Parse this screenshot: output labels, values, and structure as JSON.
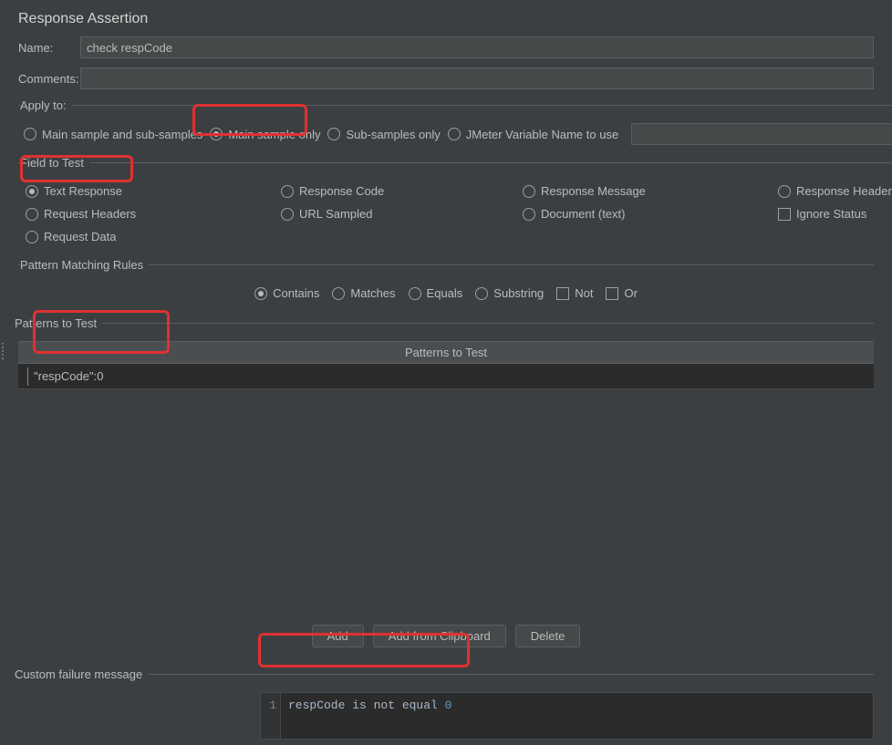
{
  "title": "Response Assertion",
  "labels": {
    "name": "Name:",
    "comments": "Comments:",
    "apply_to": "Apply to:",
    "field_to_test": "Field to Test",
    "pattern_rules": "Pattern Matching Rules",
    "patterns_to_test": "Patterns to Test",
    "custom_failure": "Custom failure message"
  },
  "fields": {
    "name_value": "check respCode",
    "comments_value": ""
  },
  "apply_to": {
    "options": [
      "Main sample and sub-samples",
      "Main sample only",
      "Sub-samples only",
      "JMeter Variable Name to use"
    ],
    "selected": "Main sample only",
    "var_value": ""
  },
  "field_to_test": {
    "row1": [
      "Text Response",
      "Response Code",
      "Response Message",
      "Response Headers"
    ],
    "row2": [
      "Request Headers",
      "URL Sampled",
      "Document (text)"
    ],
    "row3": [
      "Request Data"
    ],
    "selected": "Text Response",
    "ignore_status": "Ignore Status",
    "ignore_status_checked": false
  },
  "rules": {
    "options": [
      "Contains",
      "Matches",
      "Equals",
      "Substring"
    ],
    "selected": "Contains",
    "checks": [
      "Not",
      "Or"
    ]
  },
  "patterns": {
    "header": "Patterns to Test",
    "rows": [
      "\"respCode\":0"
    ]
  },
  "buttons": {
    "add": "Add",
    "add_clip": "Add from Clipboard",
    "delete": "Delete"
  },
  "failure_msg": {
    "line_no": "1",
    "text_prefix": "respCode is not equal ",
    "text_num": "0"
  }
}
